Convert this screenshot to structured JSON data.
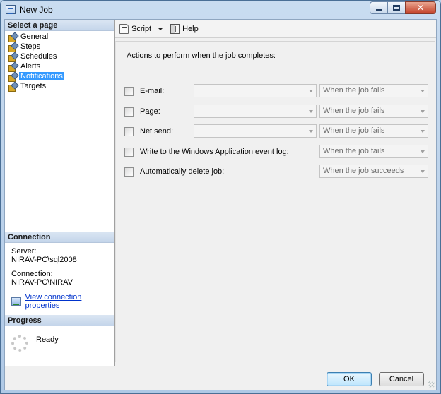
{
  "window": {
    "title": "New Job"
  },
  "left_pane": {
    "header": "Select a page",
    "pages": [
      {
        "label": "General",
        "selected": false
      },
      {
        "label": "Steps",
        "selected": false
      },
      {
        "label": "Schedules",
        "selected": false
      },
      {
        "label": "Alerts",
        "selected": false
      },
      {
        "label": "Notifications",
        "selected": true
      },
      {
        "label": "Targets",
        "selected": false
      }
    ],
    "connection": {
      "header": "Connection",
      "server_label": "Server:",
      "server_value": "NIRAV-PC\\sql2008",
      "connection_label": "Connection:",
      "connection_value": "NIRAV-PC\\NIRAV",
      "view_link": "View connection properties"
    },
    "progress": {
      "header": "Progress",
      "status": "Ready"
    }
  },
  "toolbar": {
    "script_label": "Script",
    "help_label": "Help"
  },
  "content": {
    "heading": "Actions to perform when the job completes:",
    "rows": [
      {
        "label": "E-mail:",
        "checked": false,
        "operator_value": "",
        "when_value": "When the job fails"
      },
      {
        "label": "Page:",
        "checked": false,
        "operator_value": "",
        "when_value": "When the job fails"
      },
      {
        "label": "Net send:",
        "checked": false,
        "operator_value": "",
        "when_value": "When the job fails"
      },
      {
        "label": "Write to the Windows Application event log:",
        "checked": false,
        "when_value": "When the job fails"
      },
      {
        "label": "Automatically delete job:",
        "checked": false,
        "when_value": "When the job succeeds"
      }
    ]
  },
  "buttons": {
    "ok_label": "OK",
    "cancel_label": "Cancel"
  }
}
